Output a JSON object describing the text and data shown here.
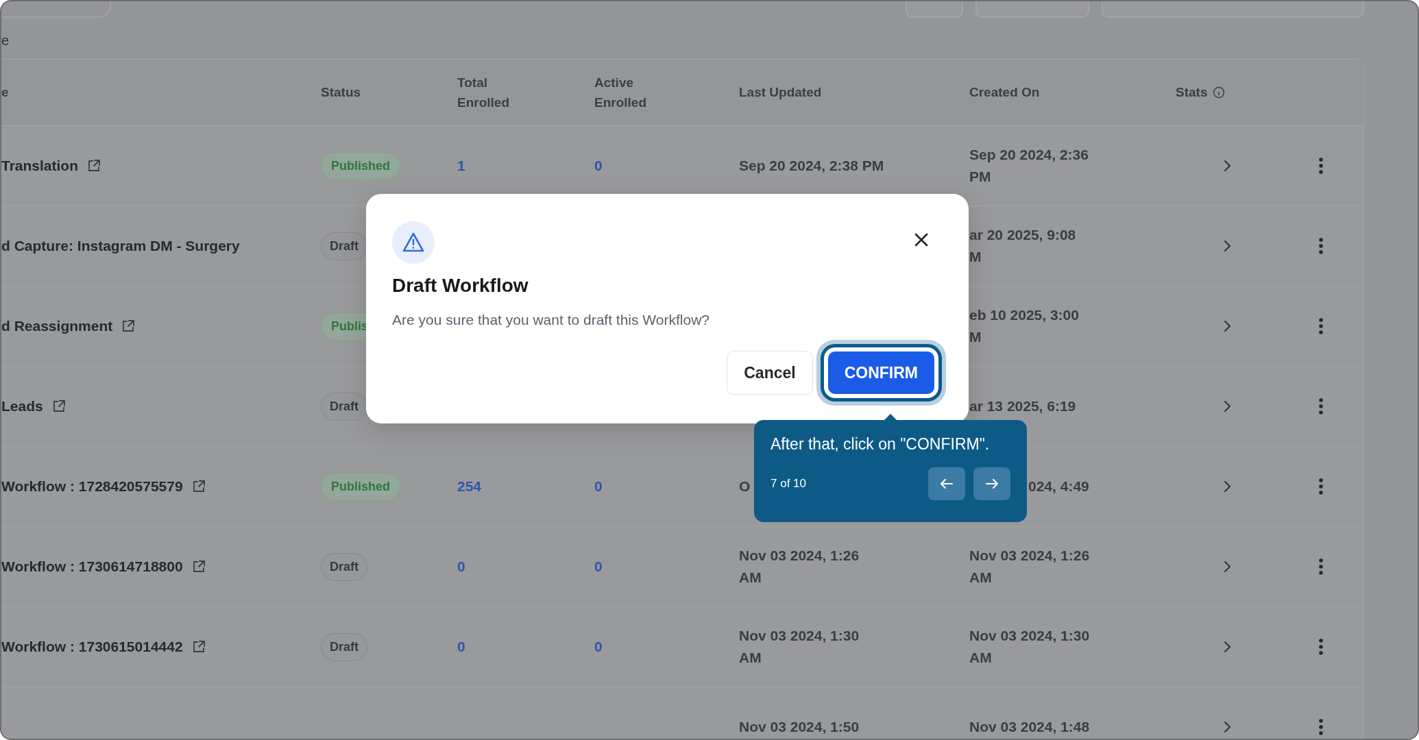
{
  "heading": "e",
  "columns": [
    {
      "label": "e"
    },
    {
      "label": "Status"
    },
    {
      "label": "Total Enrolled"
    },
    {
      "label": "Active Enrolled"
    },
    {
      "label": "Last Updated"
    },
    {
      "label": "Created On"
    },
    {
      "label": "Stats",
      "info": true
    }
  ],
  "rows": [
    {
      "name": "Translation",
      "link": true,
      "status": {
        "label": "Published",
        "kind": "published"
      },
      "total": "1",
      "active": "0",
      "last_updated": [
        "Sep 20 2024, 2:38 PM"
      ],
      "created": [
        "Sep 20 2024, 2:36",
        "PM"
      ]
    },
    {
      "name": "d Capture: Instagram DM - Surgery",
      "link": false,
      "status": {
        "label": "Draft",
        "kind": "draft"
      },
      "created": [
        "ar 20 2025, 9:08",
        "M"
      ]
    },
    {
      "name": "d Reassignment",
      "link": true,
      "status": {
        "label": "Publis",
        "kind": "published"
      },
      "created": [
        "eb 10 2025, 3:00",
        "M"
      ]
    },
    {
      "name": "Leads",
      "link": true,
      "status": {
        "label": "Draft",
        "kind": "draft"
      },
      "created": [
        "ar 13 2025, 6:19"
      ]
    },
    {
      "name": "Workflow : 1728420575579",
      "link": true,
      "status": {
        "label": "Published",
        "kind": "published"
      },
      "total": "254",
      "active": "0",
      "last_updated": [
        "O"
      ],
      "created": [
        "024, 4:49"
      ],
      "behind_tooltip": true
    },
    {
      "name": "Workflow : 1730614718800",
      "link": true,
      "status": {
        "label": "Draft",
        "kind": "draft"
      },
      "total": "0",
      "active": "0",
      "last_updated": [
        "Nov 03 2024, 1:26",
        "AM"
      ],
      "created": [
        "Nov 03 2024, 1:26",
        "AM"
      ]
    },
    {
      "name": "Workflow : 1730615014442",
      "link": true,
      "status": {
        "label": "Draft",
        "kind": "draft"
      },
      "total": "0",
      "active": "0",
      "last_updated": [
        "Nov 03 2024, 1:30",
        "AM"
      ],
      "created": [
        "Nov 03 2024, 1:30",
        "AM"
      ]
    },
    {
      "last_updated": [
        "Nov 03 2024, 1:50"
      ],
      "created": [
        "Nov 03 2024, 1:48"
      ]
    }
  ],
  "dialog": {
    "title": "Draft Workflow",
    "message": "Are you sure that you want to draft this Workflow?",
    "buttons": [
      {
        "label": "Cancel",
        "kind": "secondary"
      },
      {
        "label": "CONFIRM",
        "kind": "primary",
        "highlighted": true
      }
    ]
  },
  "tour": {
    "text": "After that, click on \"CONFIRM\".",
    "step": "7 of 10"
  }
}
